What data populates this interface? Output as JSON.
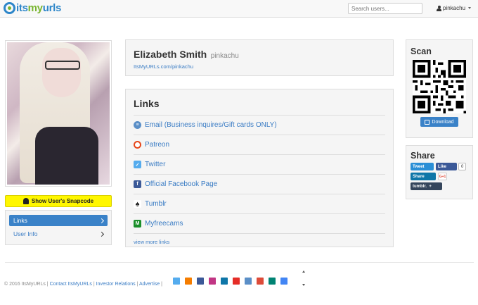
{
  "nav": {
    "logo_part1": "its",
    "logo_part2": "my",
    "logo_part3": "urls",
    "search_placeholder": "Search users...",
    "username": "pinkachu"
  },
  "profile": {
    "full_name": "Elizabeth Smith",
    "username": "pinkachu",
    "url": "ItsMyURLs.com/pinkachu"
  },
  "left": {
    "snapcode_label": "Show User's Snapcode",
    "menu": [
      {
        "label": "Links",
        "active": true
      },
      {
        "label": "User Info",
        "active": false
      }
    ]
  },
  "links": {
    "title": "Links",
    "items": [
      {
        "label": "Email (Business inquires/Gift cards ONLY)",
        "icon": "email-icon"
      },
      {
        "label": "Patreon",
        "icon": "patreon-icon"
      },
      {
        "label": "Twitter",
        "icon": "twitter-icon"
      },
      {
        "label": "Official Facebook Page",
        "icon": "facebook-icon"
      },
      {
        "label": "Tumblr",
        "icon": "tumblr-icon"
      },
      {
        "label": "Myfreecams",
        "icon": "myfreecams-icon"
      }
    ],
    "view_more": "view more links"
  },
  "scan": {
    "title": "Scan",
    "download_label": "Download"
  },
  "share": {
    "title": "Share",
    "tweet_label": "Tweet",
    "like_label": "Like",
    "like_count": "0",
    "linkedin_label": "Share",
    "gplus_label": "G+1",
    "tumblr_label": "tumblr.",
    "tumblr_plus": "+"
  },
  "footer": {
    "copyright": "© 2016 ItsMyURLs |",
    "contact": "Contact ItsMyURLs",
    "investor": "Investor Relations",
    "advertise": "Advertise",
    "sep": "|",
    "social_icons": [
      {
        "name": "twitter-icon",
        "color": "#55acee"
      },
      {
        "name": "blogger-icon",
        "color": "#f57d00"
      },
      {
        "name": "facebook-icon",
        "color": "#3b5998"
      },
      {
        "name": "instagram-icon",
        "color": "#c13584"
      },
      {
        "name": "linkedin-icon",
        "color": "#0e76a8"
      },
      {
        "name": "youtube-icon",
        "color": "#e52d27"
      },
      {
        "name": "email-icon",
        "color": "#5b8fc7"
      },
      {
        "name": "googleplus-icon",
        "color": "#dd4b39"
      },
      {
        "name": "bing-icon",
        "color": "#008373"
      },
      {
        "name": "google-icon",
        "color": "#4285f4"
      }
    ]
  },
  "colors": {
    "accent": "#3a82c8",
    "snap_yellow": "#fff700"
  }
}
